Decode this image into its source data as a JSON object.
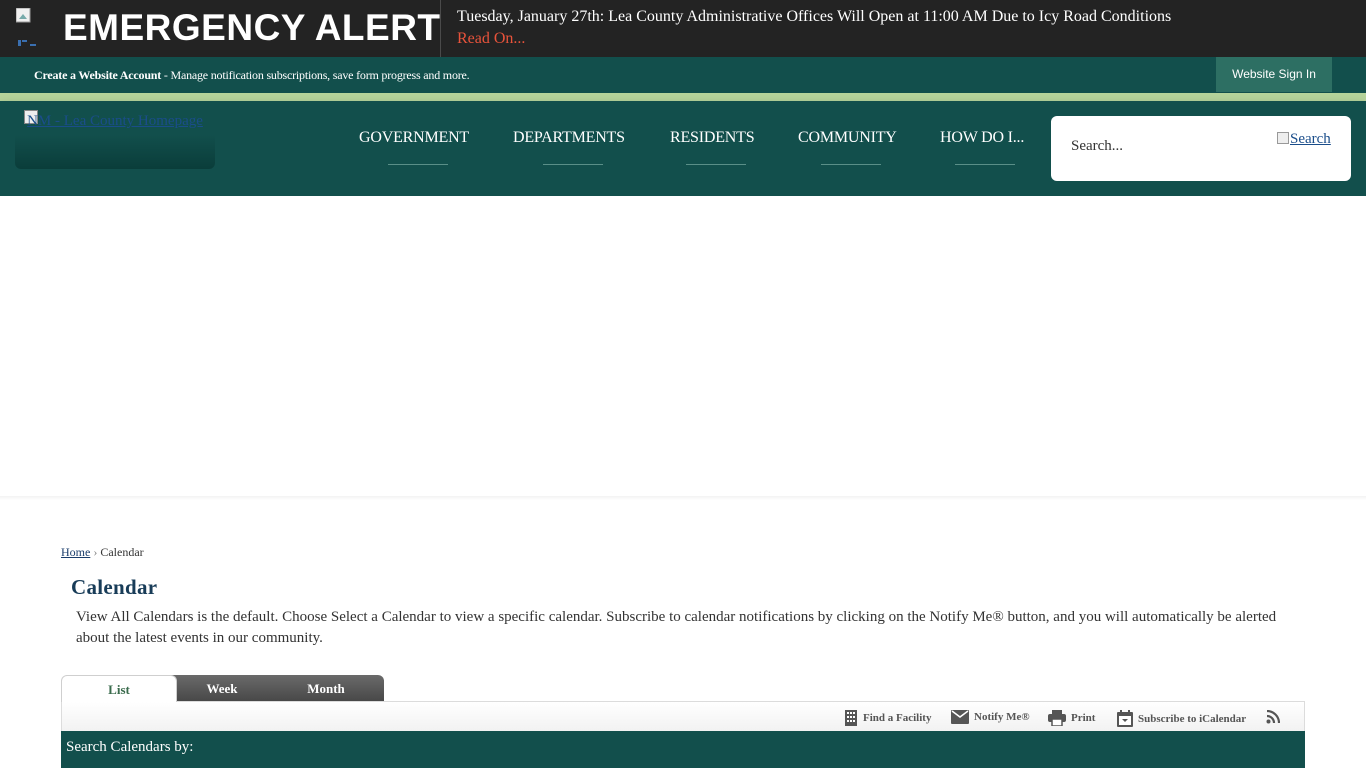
{
  "alert": {
    "title": "EMERGENCY ALERT",
    "message": "Tuesday, January 27th: Lea County Administrative Offices Will Open at 11:00 AM Due to Icy Road Conditions",
    "read_on": "Read On..."
  },
  "account_bar": {
    "create_label": "Create a Website Account",
    "description": " - Manage notification subscriptions, save form progress and more.",
    "signin_label": "Website Sign In"
  },
  "header": {
    "logo_alt": "NM - Lea County Homepage",
    "nav": [
      {
        "label": "GOVERNMENT"
      },
      {
        "label": "DEPARTMENTS"
      },
      {
        "label": "RESIDENTS"
      },
      {
        "label": "COMMUNITY"
      },
      {
        "label": "HOW DO I..."
      }
    ],
    "search_placeholder": "Search...",
    "search_button": "Search"
  },
  "breadcrumb": {
    "home": "Home",
    "separator": "›",
    "current": "Calendar"
  },
  "page": {
    "title": "Calendar",
    "intro": "View All Calendars is the default. Choose Select a Calendar to view a specific calendar. Subscribe to calendar notifications by clicking on the Notify Me® button, and you will automatically be alerted about the latest events in our community."
  },
  "tabs": [
    {
      "label": "List",
      "active": true
    },
    {
      "label": "Week",
      "active": false
    },
    {
      "label": "Month",
      "active": false
    }
  ],
  "toolbar": {
    "find_facility": "Find a Facility",
    "notify_me": "Notify Me®",
    "print": "Print",
    "subscribe": "Subscribe to iCalendar",
    "rss_icon": "rss-icon"
  },
  "search_calendars": {
    "label": "Search Calendars by:"
  },
  "colors": {
    "brand_teal": "#124f4c",
    "alert_dark": "#232323",
    "alert_link": "#e8533b",
    "stripe_green": "#b6d49b",
    "title_blue": "#183c58"
  }
}
